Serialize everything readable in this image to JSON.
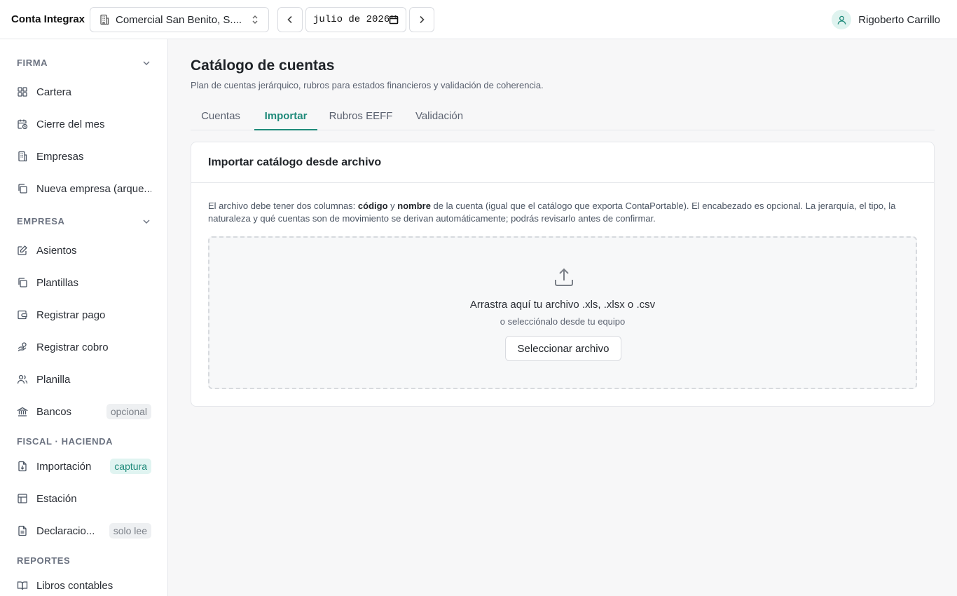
{
  "app": {
    "brand": "Conta Integrax"
  },
  "topbar": {
    "company": "Comercial San Benito, S....",
    "period": "julio de 2026",
    "user_name": "Rigoberto Carrillo"
  },
  "sidebar": {
    "sections": {
      "firma": "FIRMA",
      "empresa": "EMPRESA",
      "fiscal": "FISCAL · HACIENDA",
      "reportes": "REPORTES"
    },
    "items": {
      "cartera": "Cartera",
      "cierre": "Cierre del mes",
      "empresas": "Empresas",
      "nueva": "Nueva empresa (arque...",
      "asientos": "Asientos",
      "plantillas": "Plantillas",
      "registrar_pago": "Registrar pago",
      "registrar_cobro": "Registrar cobro",
      "planilla": "Planilla",
      "bancos": "Bancos",
      "importacion": "Importación",
      "estacion": "Estación",
      "declaraciones": "Declaracio...",
      "libros": "Libros contables"
    },
    "badges": {
      "bancos": "opcional",
      "importacion": "captura",
      "declaraciones": "solo lee"
    }
  },
  "main": {
    "title": "Catálogo de cuentas",
    "subtitle": "Plan de cuentas jerárquico, rubros para estados financieros y validación de coherencia.",
    "tabs": {
      "cuentas": "Cuentas",
      "importar": "Importar",
      "rubros": "Rubros EEFF",
      "validacion": "Validación"
    },
    "card": {
      "title": "Importar catálogo desde archivo",
      "desc_1": "El archivo debe tener dos columnas: ",
      "desc_code": "código",
      "desc_2": " y ",
      "desc_name": "nombre",
      "desc_3": " de la cuenta (igual que el catálogo que exporta ContaPortable). El encabezado es opcional. La jerarquía, el tipo, la naturaleza y qué cuentas son de movimiento se derivan automáticamente; podrás revisarlo antes de confirmar.",
      "drop_main": "Arrastra aquí tu archivo .xls, .xlsx o .csv",
      "drop_sub": "o selecciónalo desde tu equipo",
      "select_button": "Seleccionar archivo"
    }
  },
  "theme": {
    "accent": "#1f8a7a",
    "badge_teal_bg": "#e0f4f1",
    "badge_gray_bg": "#eef0f2"
  }
}
